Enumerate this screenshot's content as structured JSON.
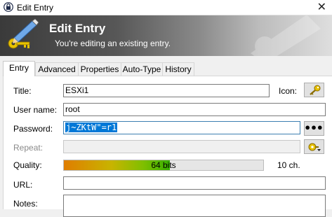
{
  "window": {
    "title": "Edit Entry",
    "close_glyph": "✕"
  },
  "banner": {
    "title": "Edit Entry",
    "subtitle": "You're editing an existing entry."
  },
  "tabs": [
    {
      "label": "Entry",
      "active": true
    },
    {
      "label": "Advanced",
      "active": false
    },
    {
      "label": "Properties",
      "active": false
    },
    {
      "label": "Auto-Type",
      "active": false
    },
    {
      "label": "History",
      "active": false
    }
  ],
  "form": {
    "title_label": "Title:",
    "title_value": "ESXi1",
    "icon_label": "Icon:",
    "username_label": "User name:",
    "username_value": "root",
    "password_label": "Password:",
    "password_value": "j~ZKtW\"=r1",
    "show_password_glyph": "●●●",
    "repeat_label": "Repeat:",
    "repeat_value": "",
    "quality_label": "Quality:",
    "quality_text": "64 bits",
    "quality_fraction": 0.53,
    "char_count": "10 ch.",
    "url_label": "URL:",
    "url_value": "",
    "notes_label": "Notes:",
    "notes_value": ""
  },
  "colors": {
    "selection": "#0078d7",
    "focus_border": "#3c7fb1"
  }
}
